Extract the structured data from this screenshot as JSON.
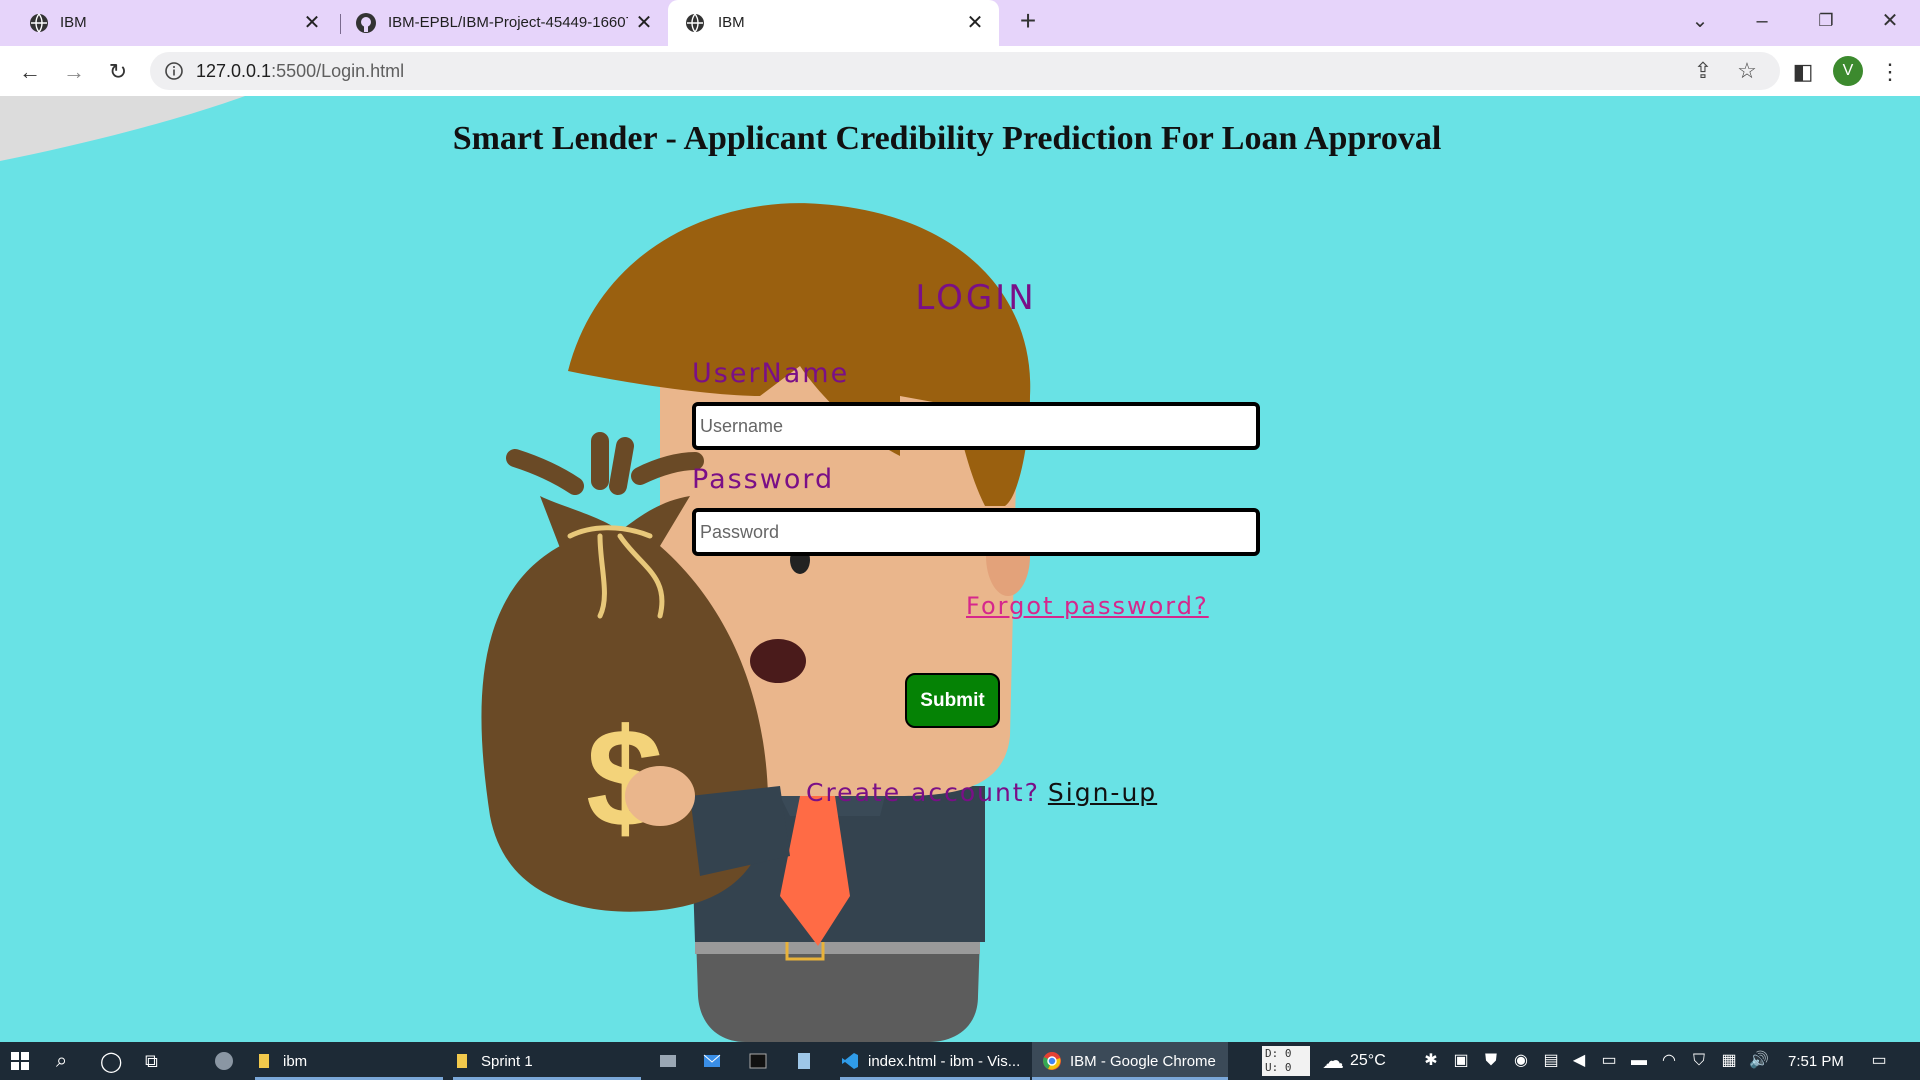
{
  "browser": {
    "tabs": [
      {
        "title": "IBM",
        "icon": "globe-icon"
      },
      {
        "title": "IBM-EPBL/IBM-Project-45449-16607",
        "icon": "github-icon"
      },
      {
        "title": "IBM",
        "icon": "globe-icon",
        "active": true
      }
    ],
    "url_host": "127.0.0.1",
    "url_rest": ":5500/Login.html",
    "avatar_letter": "V"
  },
  "page": {
    "heading": "Smart Lender - Applicant Credibility Prediction For Loan Approval",
    "login_title": "LOGIN",
    "username_label": "UserName",
    "username_placeholder": "Username",
    "password_label": "Password",
    "password_placeholder": "Password",
    "forgot_link": "Forgot password?",
    "submit_label": "Submit",
    "create_text": "Create account?",
    "signup_link": "Sign-up"
  },
  "taskbar": {
    "items": [
      {
        "label": "ibm",
        "icon": "folder-icon"
      },
      {
        "label": "Sprint 1",
        "icon": "folder-icon"
      },
      {
        "label": "index.html - ibm - Vis...",
        "icon": "vscode-icon"
      },
      {
        "label": "IBM - Google Chrome",
        "icon": "chrome-icon"
      }
    ],
    "net_down": "D: 0",
    "net_up": "U: 0",
    "weather": "25°C",
    "time": "7:51 PM"
  },
  "colors": {
    "page_background": "#69e2e5",
    "accent_purple": "#7a0f87",
    "link_pink": "#d6278c",
    "submit_green": "#058205",
    "tabstrip": "#e6d4fa"
  }
}
